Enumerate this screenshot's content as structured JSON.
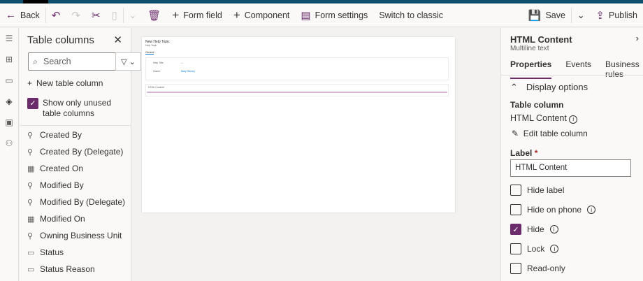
{
  "toolbar": {
    "back": "Back",
    "form_field": "Form field",
    "component": "Component",
    "form_settings": "Form settings",
    "switch_classic": "Switch to classic",
    "save": "Save",
    "publish": "Publish"
  },
  "columns": {
    "title": "Table columns",
    "search_placeholder": "Search",
    "new_column": "New table column",
    "show_unused": "Show only unused table columns",
    "show_unused_checked": true,
    "items": [
      {
        "label": "Created By",
        "icon": "lookup-icon"
      },
      {
        "label": "Created By (Delegate)",
        "icon": "lookup-icon"
      },
      {
        "label": "Created On",
        "icon": "calendar-icon"
      },
      {
        "label": "Modified By",
        "icon": "lookup-icon"
      },
      {
        "label": "Modified By (Delegate)",
        "icon": "lookup-icon"
      },
      {
        "label": "Modified On",
        "icon": "calendar-icon"
      },
      {
        "label": "Owning Business Unit",
        "icon": "lookup-icon"
      },
      {
        "label": "Status",
        "icon": "option-set-icon"
      },
      {
        "label": "Status Reason",
        "icon": "option-set-icon"
      }
    ]
  },
  "form": {
    "title": "New Help Topic",
    "subtitle": "Help Topic",
    "tab": "General",
    "fields": [
      {
        "label": "Help Title",
        "value": "---"
      },
      {
        "label": "Owner",
        "value": "Mary Harvey"
      }
    ],
    "html_label": "HTML Content"
  },
  "props": {
    "title": "HTML Content",
    "subtitle": "Multiline text",
    "tabs": [
      "Properties",
      "Events",
      "Business rules"
    ],
    "section": "Display options",
    "table_column_label": "Table column",
    "table_column_value": "HTML Content",
    "edit_column": "Edit table column",
    "label_label": "Label",
    "label_value": "HTML Content",
    "options": [
      {
        "label": "Hide label",
        "checked": false
      },
      {
        "label": "Hide on phone",
        "checked": false,
        "info": true
      },
      {
        "label": "Hide",
        "checked": true,
        "info": true
      },
      {
        "label": "Lock",
        "checked": false,
        "info": true
      },
      {
        "label": "Read-only",
        "checked": false
      }
    ]
  },
  "colors": {
    "accent": "#6b2b6b",
    "topbar": "#0d4f6c"
  }
}
